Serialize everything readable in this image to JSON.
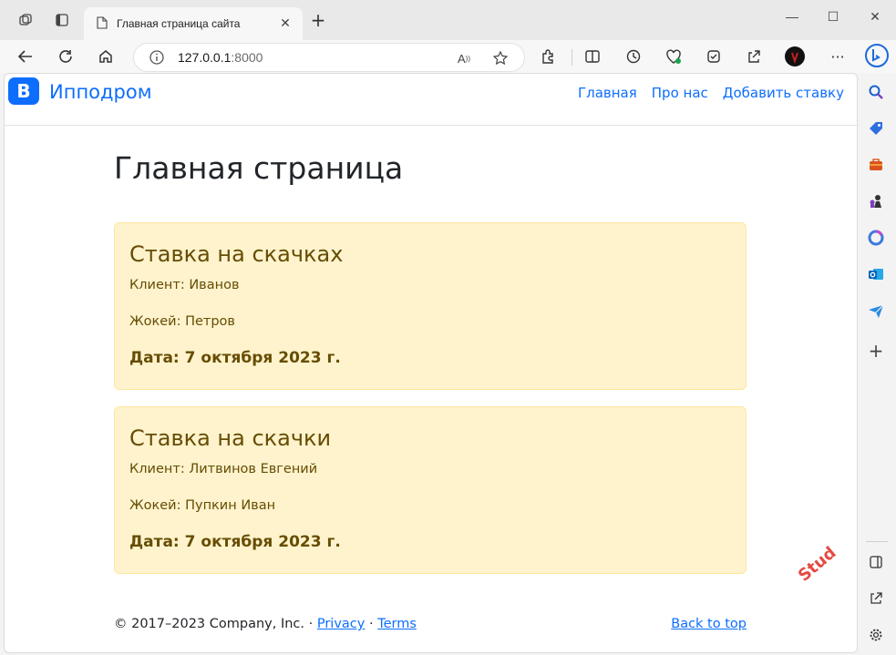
{
  "browser": {
    "tab_title": "Главная страница сайта",
    "address": {
      "host": "127.0.0.1",
      "port": ":8000"
    },
    "window_controls": {
      "minimize": "—",
      "maximize": "☐",
      "close": "✕"
    },
    "new_tab": "+",
    "tab_close": "✕",
    "more": "···",
    "reader": "A",
    "sidebar_add": "+"
  },
  "site": {
    "brand_logo_letter": "B",
    "brand_name": "Ипподром",
    "nav": [
      "Главная",
      "Про нас",
      "Добавить ставку"
    ],
    "page_title": "Главная страница",
    "cards": [
      {
        "title": "Ставка на скачках",
        "client": "Клиент: Иванов",
        "jockey": "Жокей: Петров",
        "date": "Дата: 7 октября 2023 г."
      },
      {
        "title": "Ставка на скачки",
        "client": "Клиент: Литвинов Евгений",
        "jockey": "Жокей: Пупкин Иван",
        "date": "Дата: 7 октября 2023 г."
      }
    ],
    "footer": {
      "copyright": "© 2017–2023 Company, Inc. · ",
      "privacy": "Privacy",
      "dot": " · ",
      "terms": "Terms",
      "back_to_top": "Back to top"
    }
  },
  "watermark": "Stud",
  "colors": {
    "accent": "#0d6efd",
    "card_bg": "#fff3cd",
    "card_border": "#ffe69c",
    "card_text": "#664d03"
  }
}
